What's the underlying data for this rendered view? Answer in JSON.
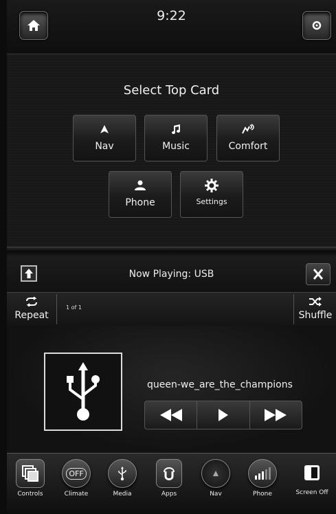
{
  "status": {
    "time": "9:22"
  },
  "card_picker": {
    "title": "Select Top Card",
    "buttons": [
      {
        "label": "Nav",
        "icon": "nav-arrow-icon"
      },
      {
        "label": "Music",
        "icon": "music-note-icon"
      },
      {
        "label": "Comfort",
        "icon": "seat-fan-icon"
      },
      {
        "label": "Phone",
        "icon": "person-icon"
      },
      {
        "label": "Settings",
        "icon": "gear-icon"
      }
    ]
  },
  "now_playing": {
    "title": "Now Playing: USB",
    "repeat_label": "Repeat",
    "shuffle_label": "Shuffle",
    "track_count": "1 of 1",
    "song": "queen-we_are_the_champions"
  },
  "dock": [
    {
      "label": "Controls",
      "icon": "controls-icon"
    },
    {
      "label": "Climate",
      "icon": "climate-off-icon",
      "badge": "OFF"
    },
    {
      "label": "Media",
      "icon": "usb-icon"
    },
    {
      "label": "Apps",
      "icon": "apps-icon"
    },
    {
      "label": "Nav",
      "icon": "compass-icon"
    },
    {
      "label": "Phone",
      "icon": "signal-bars-icon"
    },
    {
      "label": "Screen Off",
      "icon": "screen-off-icon"
    }
  ]
}
